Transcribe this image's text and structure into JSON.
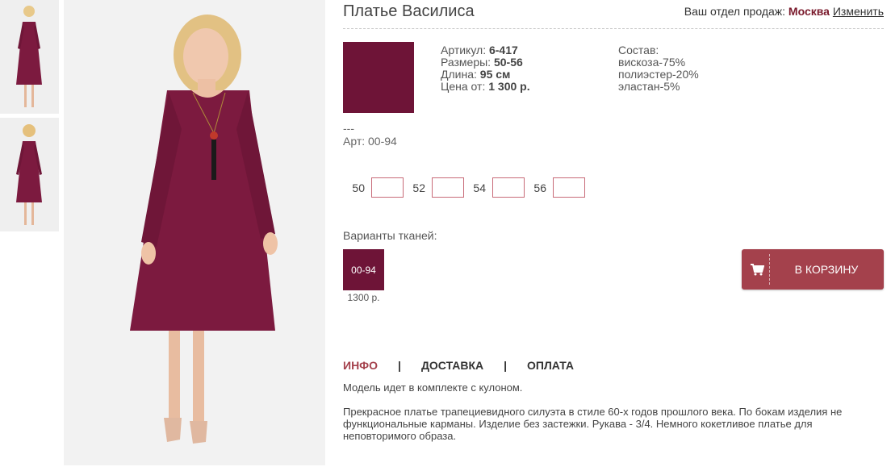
{
  "product": {
    "title": "Платье Василиса",
    "region_label": "Ваш отдел продаж:",
    "region_city": "Москва",
    "region_change": "Изменить",
    "swatch_color": "#6e1437",
    "specs": [
      {
        "label": "Артикул:",
        "value": "6-417"
      },
      {
        "label": "Размеры:",
        "value": "50-56"
      },
      {
        "label": "Длина:",
        "value": "95 см"
      },
      {
        "label": "Цена от:",
        "value": "1 300 р."
      }
    ],
    "composition": {
      "label": "Состав:",
      "items": [
        "вискоза-75%",
        "полиэстер-20%",
        "эластан-5%"
      ]
    },
    "meta_dashes": "---",
    "meta_art": "Арт: 00-94",
    "sizes": [
      "50",
      "52",
      "54",
      "56"
    ],
    "fabrics_label": "Варианты тканей:",
    "fabric": {
      "code": "00-94",
      "price": "1300 р."
    },
    "cart_label": "В КОРЗИНУ"
  },
  "tabs": [
    "ИНФО",
    "ДОСТАВКА",
    "ОПЛАТА"
  ],
  "tab_separator": "|",
  "description": [
    "Модель идет в комплекте с кулоном.",
    "Прекрасное платье трапециевидного силуэта в стиле 60-х годов прошлого века. По бокам изделия не функциональные карманы. Изделие без застежки. Рукава - 3/4. Немного кокетливое платье для неповторимого образа."
  ],
  "colors": {
    "accent": "#a4414c",
    "fabric": "#6e1437",
    "city": "#7a1a2c"
  }
}
